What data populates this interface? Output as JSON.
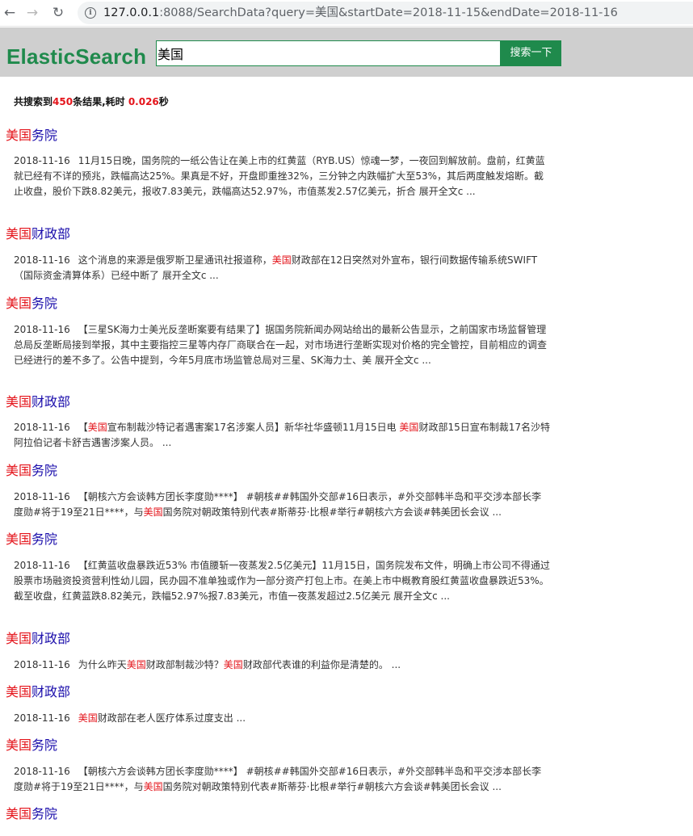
{
  "browser": {
    "url_host": "127.0.0.1",
    "url_rest": ":8088/SearchData?query=美国&startDate=2018-11-15&endDate=2018-11-16"
  },
  "header": {
    "logo": "ElasticSearch",
    "search_value": "美国",
    "search_button": "搜索一下"
  },
  "summary": {
    "prefix": "共搜索到",
    "count": "450",
    "mid": "条结果,耗时 ",
    "time": "0.026",
    "suffix": "秒"
  },
  "results": [
    {
      "title_hl": "美国",
      "title_rest": "务院",
      "date": "2018-11-16",
      "text": "11月15日晚，国务院的一纸公告让在美上市的红黄蓝（RYB.US）惊魂一梦，一夜回到解放前。盘前，红黄蓝就已经有不详的预兆，跌幅高达25%。果真是不好，开盘即重挫32%，三分钟之内跌幅扩大至53%，其后两度触发熔断。截止收盘，股价下跌8.82美元，报收7.83美元，跌幅高达52.97%，市值蒸发2.57亿美元，折合 展开全文c ..."
    },
    {
      "title_hl": "美国",
      "title_rest": "财政部",
      "date": "2018-11-16",
      "text": "这个消息的来源是俄罗斯卫星通讯社报道称，美国财政部在12日突然对外宣布，银行间数据传输系统SWIFT（国际资金清算体系）已经中断了 展开全文c ..."
    },
    {
      "title_hl": "美国",
      "title_rest": "务院",
      "date": "2018-11-16",
      "text": "【三星SK海力士美光反垄断案要有结果了】据国务院新闻办网站给出的最新公告显示，之前国家市场监督管理总局反垄断局接到举报，其中主要指控三星等内存厂商联合在一起，对市场进行垄断实现对价格的完全管控，目前相应的调查已经进行的差不多了。公告中提到，今年5月底市场监管总局对三星、SK海力士、美 展开全文c ..."
    },
    {
      "title_hl": "美国",
      "title_rest": "财政部",
      "date": "2018-11-16",
      "text": "【美国宣布制裁沙特记者遇害案17名涉案人员】新华社华盛顿11月15日电 美国财政部15日宣布制裁17名沙特阿拉伯记者卡舒吉遇害涉案人员。         ..."
    },
    {
      "title_hl": "美国",
      "title_rest": "务院",
      "date": "2018-11-16",
      "text": "【朝核六方会谈韩方团长李度勋****】 #朝核##韩国外交部#16日表示，#外交部韩半岛和平交涉本部长李度勋#将于19至21日****，与美国国务院对朝政策特别代表#斯蒂芬·比根#举行#朝核六方会谈#韩美团长会议 ..."
    },
    {
      "title_hl": "美国",
      "title_rest": "务院",
      "date": "2018-11-16",
      "text": "【红黄蓝收盘暴跌近53% 市值腰斩一夜蒸发2.5亿美元】11月15日，国务院发布文件，明确上市公司不得通过股票市场融资投资营利性幼儿园，民办园不准单独或作为一部分资产打包上市。在美上市中概教育股红黄蓝收盘暴跌近53%。截至收盘，红黄蓝跌8.82美元，跌幅52.97%报7.83美元，市值一夜蒸发超过2.5亿美元 展开全文c ..."
    },
    {
      "title_hl": "美国",
      "title_rest": "财政部",
      "date": "2018-11-16",
      "text": "为什么昨天美国财政部制裁沙特？美国财政部代表谁的利益你是清楚的。 ..."
    },
    {
      "title_hl": "美国",
      "title_rest": "财政部",
      "date": "2018-11-16",
      "text": "美国财政部在老人医疗体系过度支出 ..."
    },
    {
      "title_hl": "美国",
      "title_rest": "务院",
      "date": "2018-11-16",
      "text": "【朝核六方会谈韩方团长李度勋****】 #朝核##韩国外交部#16日表示，#外交部韩半岛和平交涉本部长李度勋#将于19至21日****，与美国国务院对朝政策特别代表#斯蒂芬·比根#举行#朝核六方会谈#韩美团长会议 ..."
    },
    {
      "title_hl": "美国",
      "title_rest": "务院",
      "date": "",
      "text": ""
    }
  ]
}
